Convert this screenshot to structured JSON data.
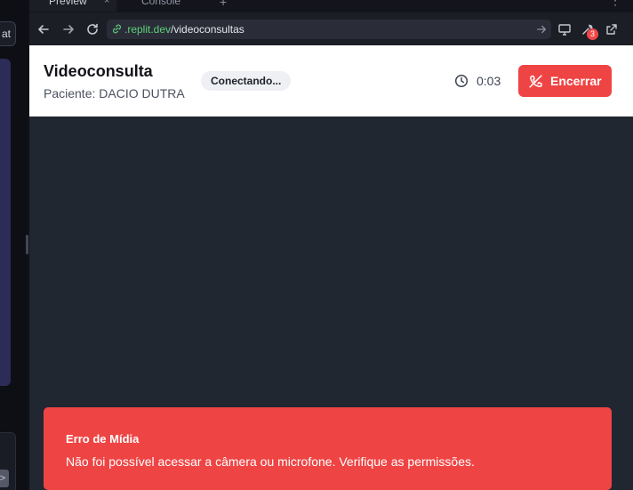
{
  "ide": {
    "chat_label": "at",
    "left_arrow": ">",
    "tabs": [
      {
        "label": "Preview",
        "close": "×"
      },
      {
        "label": "Console"
      }
    ],
    "tab_plus": "+",
    "tab_more": "⋮",
    "badge_count": "3"
  },
  "browser": {
    "url_host": ".replit.dev",
    "url_path": "/videoconsultas"
  },
  "app": {
    "title": "Videoconsulta",
    "patient": "Paciente: DACIO DUTRA",
    "status": "Conectando...",
    "timer": "0:03",
    "end_button": "Encerrar",
    "error_title": "Erro de Mídia",
    "error_message": "Não foi possível acessar a câmera ou microfone. Verifique as permissões."
  },
  "colors": {
    "accent_red": "#ef4444",
    "url_host_green": "#5fcf7a",
    "video_bg": "#212731"
  }
}
